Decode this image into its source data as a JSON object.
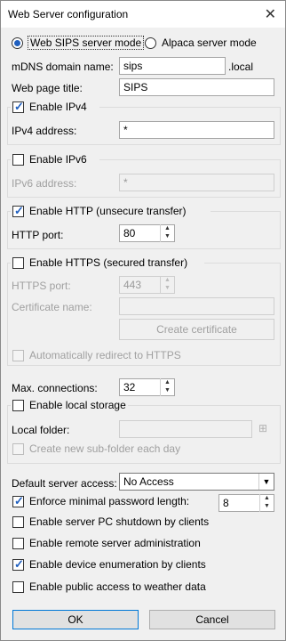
{
  "title": "Web Server configuration",
  "mode": {
    "sips_label": "Web SIPS server mode",
    "alpaca_label": "Alpaca server mode"
  },
  "mdns": {
    "label": "mDNS domain name:",
    "value": "sips",
    "suffix": ".local"
  },
  "webpage": {
    "label": "Web page title:",
    "value": "SIPS"
  },
  "ipv4": {
    "label": "Enable IPv4",
    "addr_label": "IPv4 address:",
    "addr_value": "*"
  },
  "ipv6": {
    "label": "Enable IPv6",
    "addr_label": "IPv6 address:",
    "addr_value": "*"
  },
  "http": {
    "label": "Enable HTTP (unsecure transfer)",
    "port_label": "HTTP port:",
    "port_value": "80"
  },
  "https": {
    "label": "Enable HTTPS (secured transfer)",
    "port_label": "HTTPS port:",
    "port_value": "443",
    "cert_label": "Certificate name:",
    "cert_value": "",
    "create_label": "Create certificate",
    "redirect_label": "Automatically redirect to HTTPS"
  },
  "maxconn": {
    "label": "Max. connections:",
    "value": "32"
  },
  "storage": {
    "label": "Enable local storage",
    "folder_label": "Local folder:",
    "folder_value": "",
    "subfolder_label": "Create new sub-folder each day"
  },
  "access": {
    "label": "Default server access:",
    "value": "No Access"
  },
  "password": {
    "label": "Enforce minimal password length:",
    "value": "8"
  },
  "shutdown_label": "Enable server PC shutdown by clients",
  "remote_label": "Enable remote server administration",
  "enum_label": "Enable device enumeration by clients",
  "weather_label": "Enable public access to weather data",
  "buttons": {
    "ok": "OK",
    "cancel": "Cancel"
  }
}
